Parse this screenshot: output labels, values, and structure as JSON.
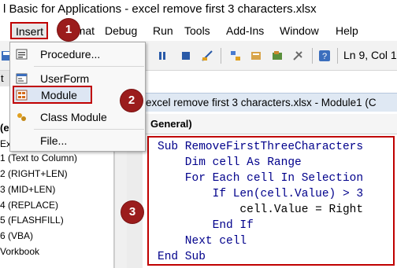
{
  "window": {
    "title": "l Basic for Applications - excel remove first 3 characters.xlsx"
  },
  "menubar": {
    "items": [
      "Insert",
      "rmat",
      "Debug",
      "Run",
      "Tools",
      "Add-Ins",
      "Window",
      "Help"
    ]
  },
  "toolbar": {
    "line_col": "Ln 9, Col 1"
  },
  "insert_menu": {
    "items": [
      {
        "label": "Procedure...",
        "icon": "procedure-icon"
      },
      {
        "label": "UserForm",
        "icon": "userform-icon"
      },
      {
        "label": "Module",
        "icon": "module-icon"
      },
      {
        "label": "Class Module",
        "icon": "class-module-icon"
      },
      {
        "label": "File...",
        "icon": ""
      }
    ]
  },
  "project_pane": {
    "items": [
      "(e",
      "Ex",
      "1 (Text to Column)",
      "2 (RIGHT+LEN)",
      "3 (MID+LEN)",
      "4 (REPLACE)",
      "5 (FLASHFILL)",
      "6 (VBA)",
      "Vorkbook"
    ],
    "header_label": "t"
  },
  "code_window": {
    "title": "excel remove first 3 characters.xlsx - Module1 (C",
    "object_combo": "General)",
    "lines": [
      "Sub RemoveFirstThreeCharacters",
      "    Dim cell As Range",
      "    For Each cell In Selection",
      "        If Len(cell.Value) > 3",
      "            cell.Value = Right",
      "        End If",
      "    Next cell",
      "End Sub"
    ]
  },
  "steps": [
    "1",
    "2",
    "3"
  ],
  "colors": {
    "highlight": "#c00000",
    "badge": "#9b1c1c"
  }
}
